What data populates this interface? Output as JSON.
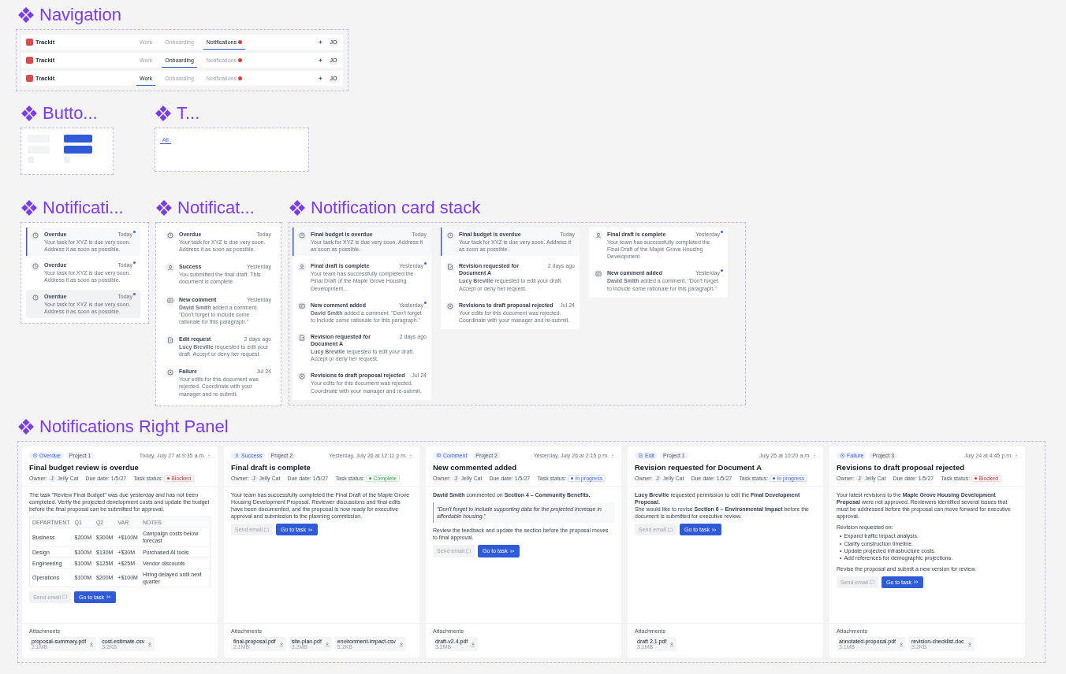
{
  "navigation": {
    "title": "Navigation",
    "bars": [
      {
        "brand": "Trackit",
        "tabs": [
          {
            "label": "Work",
            "selected": false,
            "badge": false
          },
          {
            "label": "Onboarding",
            "selected": false,
            "badge": false
          },
          {
            "label": "Notifications",
            "selected": true,
            "badge": true
          }
        ],
        "avatar": "JO"
      },
      {
        "brand": "Trackit",
        "tabs": [
          {
            "label": "Work",
            "selected": false,
            "badge": false
          },
          {
            "label": "Onboarding",
            "selected": true,
            "badge": false
          },
          {
            "label": "Notifications",
            "selected": false,
            "badge": true
          }
        ],
        "avatar": "JO"
      },
      {
        "brand": "Trackit",
        "tabs": [
          {
            "label": "Work",
            "selected": true,
            "badge": false
          },
          {
            "label": "Onboarding",
            "selected": false,
            "badge": false
          },
          {
            "label": "Notifications",
            "selected": false,
            "badge": true
          }
        ],
        "avatar": "JO"
      }
    ]
  },
  "buttons": {
    "title": "Butto...",
    "items": [
      {
        "kind": "secondary"
      },
      {
        "kind": "primary"
      },
      {
        "kind": "secondary"
      },
      {
        "kind": "primary"
      },
      {
        "kind": "icon"
      },
      {
        "kind": "icon"
      }
    ]
  },
  "tabs_section": {
    "title": "T...",
    "tabs": [
      {
        "label": "All",
        "selected": true
      }
    ]
  },
  "notification_states": {
    "title": "Notificati...",
    "items": [
      {
        "kind": "overdue",
        "title": "Overdue",
        "time": "Today",
        "body": "Your task for XYZ is due very soon. Address it as soon as possible.",
        "selected": true,
        "hovered": false,
        "unread": true
      },
      {
        "kind": "overdue",
        "title": "Overdue",
        "time": "Today",
        "body": "Your task for XYZ is due very soon. Address it as soon as possible.",
        "selected": false,
        "hovered": false,
        "unread": true
      },
      {
        "kind": "overdue",
        "title": "Overdue",
        "time": "Today",
        "body": "Your task for XYZ is due very soon. Address it as soon as possible.",
        "selected": false,
        "hovered": true,
        "unread": true
      }
    ]
  },
  "notification_types": {
    "title": "Notificat...",
    "items": [
      {
        "kind": "overdue",
        "title": "Overdue",
        "time": "Today",
        "body": "Your task for XYZ is due very soon. Address it as soon as possible.",
        "selected": false,
        "hovered": false,
        "unread": false
      },
      {
        "kind": "success",
        "title": "Success",
        "time": "Yesterday",
        "body": "You submitted the final draft. This document is complete.",
        "selected": false,
        "hovered": false,
        "unread": false
      },
      {
        "kind": "comment",
        "title": "New comment",
        "time": "Yesterday",
        "body": "**David Smith** added a comment. \"Don't forget to include some rationale for this paragraph.\"",
        "selected": false,
        "hovered": false,
        "unread": false
      },
      {
        "kind": "edit",
        "title": "Edit request",
        "time": "2 days ago",
        "body": "**Lucy Breville** requested to edit your draft. Accept or deny her request.",
        "selected": false,
        "hovered": false,
        "unread": false
      },
      {
        "kind": "failure",
        "title": "Failure",
        "time": "Jul 24",
        "body": "Your edits for this document was rejected. Coordinate with your manager and re-submit.",
        "selected": false,
        "hovered": false,
        "unread": false
      }
    ]
  },
  "card_stack": {
    "title": "Notification card stack",
    "columns": [
      {
        "items": [
          {
            "kind": "overdue",
            "title": "Final budget is overdue",
            "time": "Today",
            "body": "Your task for XYZ is due very soon. Address it as soon as possible.",
            "selected": true,
            "hovered": false,
            "unread": false
          },
          {
            "kind": "success",
            "title": "Final draft is complete",
            "time": "Yesterday",
            "body": "Your team has successfully completed the Final Draft of the Maple Grove Housing Development...",
            "selected": false,
            "hovered": false,
            "unread": true
          },
          {
            "kind": "comment",
            "title": "New comment added",
            "time": "Yesterday",
            "body": "**David Smith** added a comment. \"Don't forget to include some rationale for this paragraph.\"",
            "selected": false,
            "hovered": false,
            "unread": true
          },
          {
            "kind": "edit",
            "title": "Revision requested for Document A",
            "time": "2 days ago",
            "body": "**Lucy Breville** requested to edit your draft. Accept or deny her request.",
            "selected": false,
            "hovered": false,
            "unread": false
          },
          {
            "kind": "failure",
            "title": "Revisions to draft proposal rejected",
            "time": "Jul 24",
            "body": "Your edits for this document was rejected. Coordinate with your manager and re-submit.",
            "selected": false,
            "hovered": false,
            "unread": false
          }
        ]
      },
      {
        "items": [
          {
            "kind": "overdue",
            "title": "Final budget is overdue",
            "time": "Today",
            "body": "Your task for XYZ is due very soon. Address it as soon as possible.",
            "selected": true,
            "hovered": false,
            "unread": false
          },
          {
            "kind": "edit",
            "title": "Revision requested for Document A",
            "time": "2 days ago",
            "body": "**Lucy Breville** requested to edit your draft. Accept or deny her request.",
            "selected": false,
            "hovered": false,
            "unread": false
          },
          {
            "kind": "failure",
            "title": "Revisions to draft proposal rejected",
            "time": "Jul 24",
            "body": "Your edits for this document was rejected. Coordinate with your manager and re-submit.",
            "selected": false,
            "hovered": false,
            "unread": false
          }
        ]
      },
      {
        "items": [
          {
            "kind": "success",
            "title": "Final draft is complete",
            "time": "Yesterday",
            "body": "Your team has successfully completed the Final Draft of the Maple Grove Housing Development.",
            "selected": false,
            "hovered": false,
            "unread": true
          },
          {
            "kind": "comment",
            "title": "New comment added",
            "time": "Yesterday",
            "body": "**David Smith** added a comment. \"Don't forget to include some rationale for this paragraph.\"",
            "selected": false,
            "hovered": false,
            "unread": true
          }
        ]
      }
    ]
  },
  "right_panel": {
    "title": "Notifications Right Panel",
    "cards": [
      {
        "status": {
          "kind": "overdue",
          "label": "Overdue"
        },
        "project": "Project 1",
        "date": "Today, July 27 at 9:35 a.m.",
        "title": "Final budget review is overdue",
        "owner_label": "Owner:",
        "owner_initial": "J",
        "owner": "Jelly Cat",
        "due_label": "Due date:",
        "due": "1/5/27",
        "status_label": "Task status:",
        "task_status": {
          "kind": "blocked",
          "label": "Blocked"
        },
        "body": [
          {
            "kind": "paragraph",
            "text": "The task \"Review Final Budget\" was due yesterday and has not been completed. Verify the projected development costs and update the budget before the final proposal can be submitted for approval."
          },
          {
            "kind": "table",
            "columns": [
              "DEPARTMENT",
              "Q1",
              "Q2",
              "VAR",
              "NOTES"
            ],
            "rows": [
              [
                "Business",
                "$200M",
                "$300M",
                "+$100M",
                "Campaign costs below forecast"
              ],
              [
                "Design",
                "$100M",
                "$130M",
                "+$30M",
                "Purchased AI tools"
              ],
              [
                "Engineering",
                "$100M",
                "$125M",
                "+$25M",
                "Vendor discounts"
              ],
              [
                "Operations",
                "$100M",
                "$200M",
                "+$100M",
                "Hiring delayed until next quarter"
              ]
            ]
          }
        ],
        "actions": [
          "Send email",
          "Go to task"
        ],
        "attachments_label": "Attachments",
        "attachments": [
          {
            "name": "proposal-summary.pdf",
            "size": "2.1MB"
          },
          {
            "name": "cost-estimate.csv",
            "size": "3.2KB"
          }
        ]
      },
      {
        "status": {
          "kind": "success",
          "label": "Success"
        },
        "project": "Project 2",
        "date": "Yesterday, July 26 at 12:11 p.m.",
        "title": "Final draft is complete",
        "owner_label": "Owner:",
        "owner_initial": "J",
        "owner": "Jelly Cat",
        "due_label": "Due date:",
        "due": "1/5/27",
        "status_label": "Task status:",
        "task_status": {
          "kind": "complete",
          "label": "Complete"
        },
        "body": [
          {
            "kind": "paragraph",
            "text": "Your team has successfully completed the Final Draft of the Maple Grove Housing Development Proposal. Reviewer discussions and final edits have been documented, and the proposal is now ready for executive approval and submission to the planning commission."
          }
        ],
        "actions": [
          "Send email",
          "Go to task"
        ],
        "attachments_label": "Attachments",
        "attachments": [
          {
            "name": "final-proposal.pdf",
            "size": "2.1MB"
          },
          {
            "name": "site-plan.pdf",
            "size": "3.2MB"
          },
          {
            "name": "environment-impact.csv",
            "size": "5.2KB"
          }
        ]
      },
      {
        "status": {
          "kind": "comment",
          "label": "Comment"
        },
        "project": "Project 2",
        "date": "Yesterday, July 26 at 2:15 p.m.",
        "title": "New commented added",
        "owner_label": "Owner:",
        "owner_initial": "J",
        "owner": "Jelly Cat",
        "due_label": "Due date:",
        "due": "1/5/27",
        "status_label": "Task status:",
        "task_status": {
          "kind": "progress",
          "label": "In progress"
        },
        "body": [
          {
            "kind": "paragraph",
            "text": "**David Smith** commented on **Section 4 – Community Benefits.**"
          },
          {
            "kind": "quote",
            "text": "\"Don't forget to include supporting data for the projected increase in affordable housing.\""
          },
          {
            "kind": "paragraph",
            "text": "Review the feedback and update the section before the proposal moves to final approval."
          }
        ],
        "actions": [
          "Send email",
          "Go to task"
        ],
        "attachments_label": "Attachments",
        "attachments": [
          {
            "name": "draft-v2.4.pdf",
            "size": "3.2MB"
          }
        ]
      },
      {
        "status": {
          "kind": "edit",
          "label": "Edit"
        },
        "project": "Project 1",
        "date": "July 25 at 10:20 a.m.",
        "title": "Revision requested for Document A",
        "owner_label": "Owner:",
        "owner_initial": "J",
        "owner": "Jelly Cat",
        "due_label": "Due date:",
        "due": "1/5/27",
        "status_label": "Task status:",
        "task_status": {
          "kind": "progress",
          "label": "In progress"
        },
        "body": [
          {
            "kind": "paragraph",
            "text": "**Lucy Breville** requested permission to edit the **Final Development Proposal.**"
          },
          {
            "kind": "tight",
            "text": "She would like to revise **Section 6 – Environmental Impact** before the document is submitted for executive review."
          }
        ],
        "actions": [
          "Send email",
          "Go to task"
        ],
        "attachments_label": "Attachments",
        "attachments": [
          {
            "name": "draft 2.1.pdf",
            "size": "3.1MB"
          }
        ]
      },
      {
        "status": {
          "kind": "failure",
          "label": "Failure"
        },
        "project": "Project 3",
        "date": "July 24 at 4:45 p.m.",
        "title": "Revisions to draft proposal rejected",
        "owner_label": "Owner:",
        "owner_initial": "J",
        "owner": "Jelly Cat",
        "due_label": "Due date:",
        "due": "1/5/27",
        "status_label": "Task status:",
        "task_status": {
          "kind": "blocked",
          "label": "Blocked"
        },
        "body": [
          {
            "kind": "paragraph",
            "text": "Your latest revisions to the **Maple Grove Housing Development Proposal** were not approved. Reviewers identified several issues that must be addressed before the proposal can move forward for executive approval."
          },
          {
            "kind": "paragraph",
            "text": "Revision requested on:"
          },
          {
            "kind": "list",
            "marker": "•",
            "items": [
              "Expand traffic impact analysis.",
              "Clarify construction timeline.",
              "Update projected infrastructure costs.",
              "Add references for demographic projections."
            ]
          },
          {
            "kind": "paragraph",
            "text": "Revise the proposal and submit a new version for review."
          }
        ],
        "actions": [
          "Send email",
          "Go to task"
        ],
        "attachments_label": "Attachments",
        "attachments": [
          {
            "name": "annotated-proposal.pdf",
            "size": "3.1MB"
          },
          {
            "name": "revision-checklist.doc",
            "size": "3.2KB"
          }
        ]
      }
    ]
  }
}
